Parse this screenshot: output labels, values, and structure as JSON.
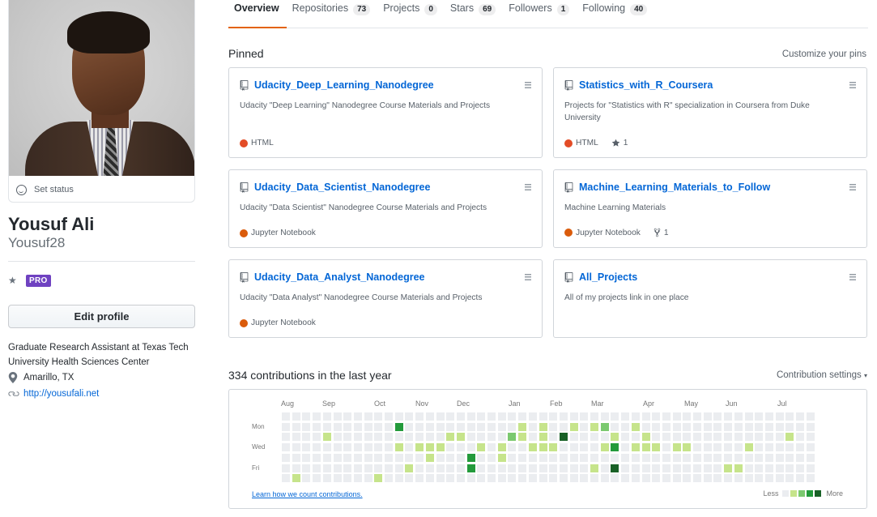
{
  "profile": {
    "set_status": "Set status",
    "name": "Yousuf Ali",
    "login": "Yousuf28",
    "pro_badge": "PRO",
    "edit_profile": "Edit profile",
    "bio": "Graduate Research Assistant at Texas Tech University Health Sciences Center",
    "location": "Amarillo, TX",
    "website": "http://yousufali.net"
  },
  "tabs": [
    {
      "label": "Overview",
      "count": null,
      "selected": true
    },
    {
      "label": "Repositories",
      "count": "73"
    },
    {
      "label": "Projects",
      "count": "0"
    },
    {
      "label": "Stars",
      "count": "69"
    },
    {
      "label": "Followers",
      "count": "1"
    },
    {
      "label": "Following",
      "count": "40"
    }
  ],
  "pinned": {
    "title": "Pinned",
    "customize": "Customize your pins",
    "repos": [
      {
        "name": "Udacity_Deep_Learning_Nanodegree",
        "description": "Udacity \"Deep Learning\" Nanodegree Course Materials and Projects",
        "language": "HTML",
        "lang_color": "#e34c26"
      },
      {
        "name": "Statistics_with_R_Coursera",
        "description": "Projects for \"Statistics with R\" specialization in Coursera from Duke University",
        "language": "HTML",
        "lang_color": "#e34c26",
        "stars": "1"
      },
      {
        "name": "Udacity_Data_Scientist_Nanodegree",
        "description": "Udacity \"Data Scientist\" Nanodegree Course Materials and Projects",
        "language": "Jupyter Notebook",
        "lang_color": "#DA5B0B"
      },
      {
        "name": "Machine_Learning_Materials_to_Follow",
        "description": "Machine Learning Materials",
        "language": "Jupyter Notebook",
        "lang_color": "#DA5B0B",
        "forks": "1"
      },
      {
        "name": "Udacity_Data_Analyst_Nanodegree",
        "description": "Udacity \"Data Analyst\" Nanodegree Course Materials and Projects",
        "language": "Jupyter Notebook",
        "lang_color": "#DA5B0B"
      },
      {
        "name": "All_Projects",
        "description": "All of my projects link in one place"
      }
    ]
  },
  "contributions": {
    "title": "334 contributions in the last year",
    "settings": "Contribution settings",
    "months": [
      "Aug",
      "Sep",
      "Oct",
      "Nov",
      "Dec",
      "Jan",
      "Feb",
      "Mar",
      "Apr",
      "May",
      "Jun",
      "Jul"
    ],
    "day_labels": [
      "Mon",
      "Wed",
      "Fri"
    ],
    "learn_link": "Learn how we count contributions.",
    "legend_less": "Less",
    "legend_more": "More",
    "colors": [
      "#ebedf0",
      "#c6e48b",
      "#7bc96f",
      "#239a3b",
      "#196127"
    ],
    "weeks": [
      [
        0,
        0,
        0,
        0,
        0,
        0,
        0
      ],
      [
        0,
        0,
        0,
        0,
        0,
        0,
        1
      ],
      [
        0,
        0,
        0,
        0,
        0,
        0,
        0
      ],
      [
        0,
        0,
        0,
        0,
        0,
        0,
        0
      ],
      [
        0,
        0,
        1,
        0,
        0,
        0,
        0
      ],
      [
        0,
        0,
        0,
        0,
        0,
        0,
        0
      ],
      [
        0,
        0,
        0,
        0,
        0,
        0,
        0
      ],
      [
        0,
        0,
        0,
        0,
        0,
        0,
        0
      ],
      [
        0,
        0,
        0,
        0,
        0,
        0,
        0
      ],
      [
        0,
        0,
        0,
        0,
        0,
        0,
        1
      ],
      [
        0,
        0,
        0,
        0,
        0,
        0,
        0
      ],
      [
        0,
        3,
        0,
        1,
        0,
        0,
        0
      ],
      [
        0,
        0,
        0,
        0,
        0,
        1,
        0
      ],
      [
        0,
        0,
        0,
        1,
        0,
        0,
        0
      ],
      [
        0,
        0,
        0,
        1,
        1,
        0,
        0
      ],
      [
        0,
        0,
        0,
        1,
        0,
        0,
        0
      ],
      [
        0,
        0,
        1,
        0,
        0,
        0,
        0
      ],
      [
        0,
        0,
        1,
        0,
        0,
        0,
        0
      ],
      [
        0,
        0,
        0,
        0,
        3,
        3,
        0
      ],
      [
        0,
        0,
        0,
        1,
        0,
        0,
        0
      ],
      [
        0,
        0,
        0,
        0,
        0,
        0,
        0
      ],
      [
        0,
        0,
        0,
        1,
        1,
        0,
        0
      ],
      [
        0,
        0,
        2,
        0,
        0,
        0,
        0
      ],
      [
        0,
        1,
        1,
        0,
        0,
        0,
        0
      ],
      [
        0,
        0,
        0,
        1,
        0,
        0,
        0
      ],
      [
        0,
        1,
        1,
        1,
        0,
        0,
        0
      ],
      [
        0,
        0,
        0,
        1,
        0,
        0,
        0
      ],
      [
        0,
        0,
        4,
        0,
        0,
        0,
        0
      ],
      [
        0,
        1,
        0,
        0,
        0,
        0,
        0
      ],
      [
        0,
        0,
        0,
        0,
        0,
        0,
        0
      ],
      [
        0,
        1,
        0,
        0,
        0,
        1,
        0
      ],
      [
        0,
        2,
        0,
        1,
        0,
        0,
        0
      ],
      [
        0,
        0,
        1,
        3,
        0,
        4,
        0
      ],
      [
        0,
        0,
        0,
        0,
        0,
        0,
        0
      ],
      [
        0,
        1,
        0,
        1,
        0,
        0,
        0
      ],
      [
        0,
        0,
        1,
        1,
        0,
        0,
        0
      ],
      [
        0,
        0,
        0,
        1,
        0,
        0,
        0
      ],
      [
        0,
        0,
        0,
        0,
        0,
        0,
        0
      ],
      [
        0,
        0,
        0,
        1,
        0,
        0,
        0
      ],
      [
        0,
        0,
        0,
        1,
        0,
        0,
        0
      ],
      [
        0,
        0,
        0,
        0,
        0,
        0,
        0
      ],
      [
        0,
        0,
        0,
        0,
        0,
        0,
        0
      ],
      [
        0,
        0,
        0,
        0,
        0,
        0,
        0
      ],
      [
        0,
        0,
        0,
        0,
        0,
        1,
        0
      ],
      [
        0,
        0,
        0,
        0,
        0,
        1,
        0
      ],
      [
        0,
        0,
        0,
        1,
        0,
        0,
        0
      ],
      [
        0,
        0,
        0,
        0,
        0,
        0,
        0
      ],
      [
        0,
        0,
        0,
        0,
        0,
        0,
        0
      ],
      [
        0,
        0,
        0,
        0,
        0,
        0,
        0
      ],
      [
        0,
        0,
        1,
        0,
        0,
        0,
        0
      ],
      [
        0,
        0,
        0,
        0,
        0,
        0,
        0
      ],
      [
        0,
        0,
        0,
        0,
        0,
        0,
        0
      ]
    ]
  }
}
